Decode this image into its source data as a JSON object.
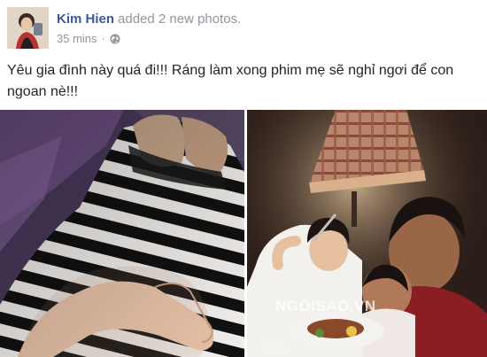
{
  "post": {
    "author_name": "Kim Hien",
    "action": "added 2 new photos.",
    "timestamp": "35 mins",
    "separator": "·",
    "privacy_icon": "globe-icon",
    "text": "Yêu gia đình này quá đi!!! Ráng làm xong phim mẹ sẽ nghỉ ngơi để con ngoan nè!!!"
  },
  "photos": [
    {
      "description_icon": "photo-belly-striped-dress"
    },
    {
      "description_icon": "photo-family-restaurant"
    }
  ],
  "watermark": {
    "text": "NGOISAO.VN"
  },
  "colors": {
    "link": "#3b5998",
    "meta": "#90949c",
    "text": "#1d2129"
  }
}
